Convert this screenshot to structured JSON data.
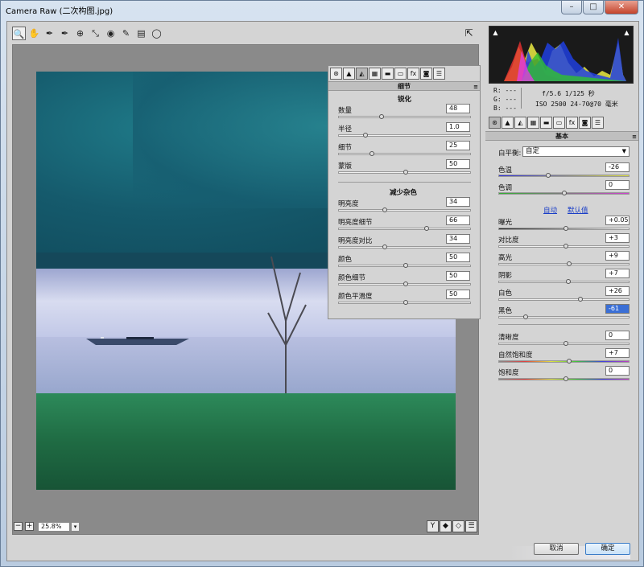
{
  "window": {
    "title": "Camera Raw (二次构图.jpg)",
    "min": "–",
    "max": "□",
    "close": "✕"
  },
  "toolbar": {
    "tools": [
      "🔍",
      "✋",
      "✒",
      "✒",
      "⊕",
      "⤡",
      "◉",
      "✎",
      "▤",
      "◯"
    ],
    "right_icon": "⇱"
  },
  "bottom": {
    "zoom_minus": "−",
    "zoom_plus": "+",
    "zoom_value": "25.8%",
    "zoom_dd": "▾",
    "view_icons": [
      "Y",
      "◆",
      "◇",
      "☰"
    ]
  },
  "histogram": {
    "clip_shadow": "▲",
    "clip_highlight": "▲"
  },
  "info": {
    "r": "R:  ---",
    "g": "G:  ---",
    "b": "B:  ---",
    "exif1": "f/5.6   1/125 秒",
    "exif2": "ISO 2500   24-70@70 毫米"
  },
  "panel_tabs": [
    "⊛",
    "▲",
    "◭",
    "▦",
    "▬",
    "▭",
    "fx",
    "◙",
    "☰"
  ],
  "basic": {
    "header": "基本",
    "wb_label": "白平衡:",
    "wb_value": "自定",
    "temp": {
      "label": "色温",
      "value": "-26"
    },
    "tint": {
      "label": "色调",
      "value": "0"
    },
    "auto": "自动",
    "default": "默认值",
    "exposure": {
      "label": "曝光",
      "value": "+0.05"
    },
    "contrast": {
      "label": "对比度",
      "value": "+3"
    },
    "highlights": {
      "label": "高光",
      "value": "+9"
    },
    "shadows": {
      "label": "阴影",
      "value": "+7"
    },
    "whites": {
      "label": "白色",
      "value": "+26"
    },
    "blacks": {
      "label": "黑色",
      "value": "-61"
    },
    "clarity": {
      "label": "清晰度",
      "value": "0"
    },
    "vibrance": {
      "label": "自然饱和度",
      "value": "+7"
    },
    "saturation": {
      "label": "饱和度",
      "value": "0"
    }
  },
  "detail": {
    "header": "细节",
    "sharpen_title": "锐化",
    "amount": {
      "label": "数量",
      "value": "48"
    },
    "radius": {
      "label": "半径",
      "value": "1.0"
    },
    "detail": {
      "label": "细节",
      "value": "25"
    },
    "masking": {
      "label": "蒙版",
      "value": "50"
    },
    "nr_title": "减少杂色",
    "lum": {
      "label": "明亮度",
      "value": "34"
    },
    "lum_detail": {
      "label": "明亮度细节",
      "value": "66"
    },
    "lum_contrast": {
      "label": "明亮度对比",
      "value": "34"
    },
    "color": {
      "label": "颜色",
      "value": "50"
    },
    "color_detail": {
      "label": "颜色细节",
      "value": "50"
    },
    "color_smooth": {
      "label": "颜色平滑度",
      "value": "50"
    }
  },
  "buttons": {
    "cancel": "取消",
    "ok": "确定"
  },
  "menu_icon": "≡"
}
